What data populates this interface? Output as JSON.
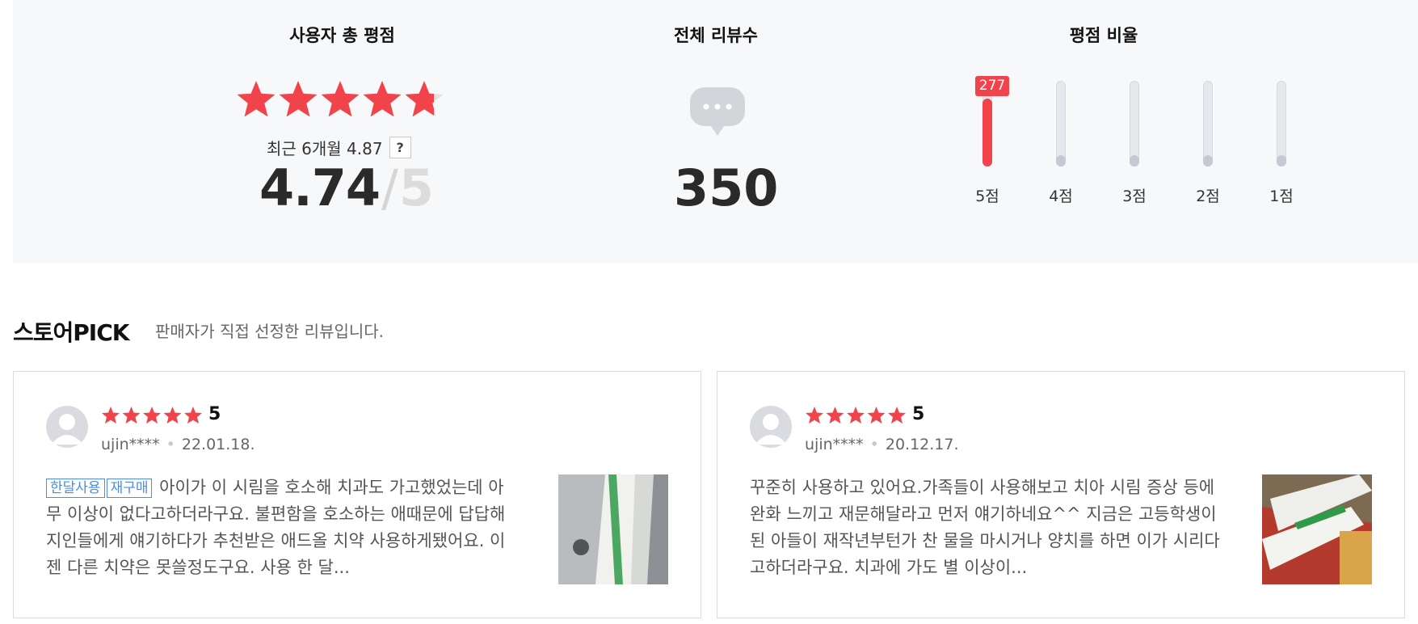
{
  "summary": {
    "rating_title": "사용자 총 평점",
    "reviews_title": "전체 리뷰수",
    "ratio_title": "평점 비율",
    "recent_label": "최근 6개월 4.87",
    "help_label": "?",
    "score": "4.74",
    "score_slash": "/",
    "score_max": "5",
    "stars_filled": 4.74,
    "review_count": "350",
    "bars": [
      {
        "label": "5점",
        "count": "277",
        "fill_fraction": 0.79
      },
      {
        "label": "4점"
      },
      {
        "label": "3점"
      },
      {
        "label": "2점"
      },
      {
        "label": "1점"
      }
    ]
  },
  "store_pick": {
    "title": "스토어PICK",
    "description": "판매자가 직접 선정한 리뷰입니다."
  },
  "reviews": [
    {
      "score": "5",
      "user": "ujin****",
      "date": "22.01.18.",
      "tags": [
        "한달사용",
        "재구매"
      ],
      "text": "아이가 이 시림을 호소해 치과도 가고했었는데 아무 이상이 없다고하더라구요. 불편함을 호소하는 애때문에 답답해 지인들에게 얘기하다가 추천받은 애드올 치약 사용하게됐어요. 이젠 다른 치약은 못쓸정도구요. 사용 한 달..."
    },
    {
      "score": "5",
      "user": "ujin****",
      "date": "20.12.17.",
      "tags": [],
      "text": "꾸준히 사용하고 있어요.가족들이 사용해보고 치아 시림 증상 등에 완화 느끼고 재문해달라고 먼저 얘기하네요^^ 지금은 고등학생이 된 아들이 재작년부턴가 찬 물을 마시거나 양치를 하면 이가 시리다고하더라구요. 치과에 가도 별 이상이..."
    }
  ],
  "colors": {
    "accent": "#f0444a",
    "tag": "#4a8ce8",
    "band": "#f7f8fa"
  }
}
